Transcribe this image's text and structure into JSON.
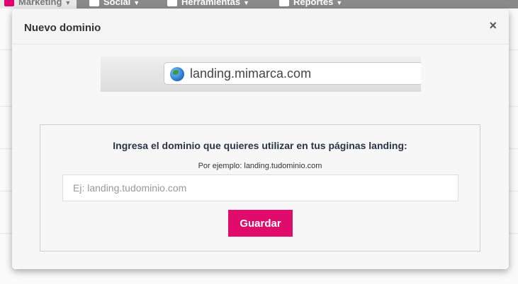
{
  "nav": {
    "items": [
      {
        "label": "Marketing",
        "icon": "list-icon"
      },
      {
        "label": "Social",
        "icon": "chat-icon"
      },
      {
        "label": "Herramientas",
        "icon": "wrench-icon"
      },
      {
        "label": "Reportes",
        "icon": "bar-chart-icon"
      }
    ]
  },
  "modal": {
    "title": "Nuevo dominio",
    "close_label": "×",
    "browser_mock": {
      "url": "landing.mimarca.com",
      "icon": "globe-icon"
    },
    "form": {
      "heading": "Ingresa el dominio que quieres utilizar en tus páginas landing:",
      "example": "Por ejemplo: landing.tudominio.com",
      "input_placeholder": "Ej: landing.tudominio.com",
      "input_value": "",
      "save_label": "Guardar"
    }
  },
  "colors": {
    "accent": "#e00b6b",
    "nav_bg": "#8a8a8a"
  }
}
